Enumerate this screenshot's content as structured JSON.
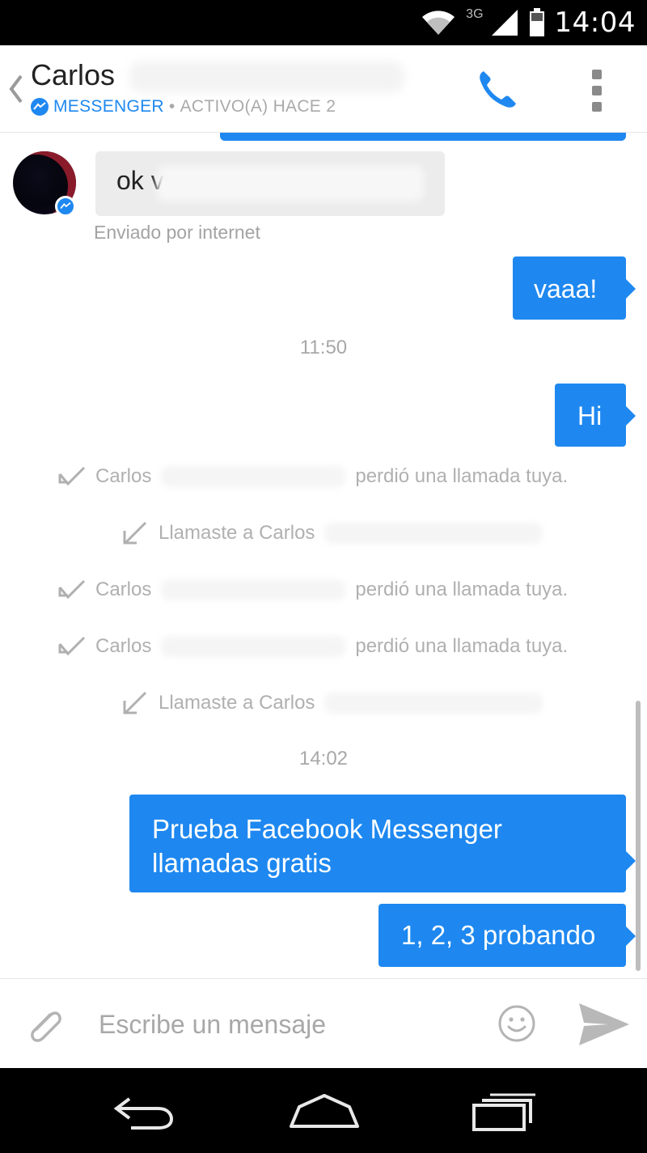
{
  "status_bar": {
    "time": "14:04",
    "network": "3G",
    "icons": [
      "wifi-icon",
      "signal-icon",
      "battery-icon"
    ]
  },
  "header": {
    "contact_name": "Carlos",
    "app_label": "MESSENGER",
    "separator": "•",
    "status": "ACTIVO(A) HACE 2",
    "icons": [
      "back-icon",
      "phone-icon",
      "more-icon"
    ]
  },
  "conversation": {
    "incoming": {
      "text": "ok v",
      "note": "Enviado por internet"
    },
    "outgoing_1": "vaaa!",
    "time_1": "11:50",
    "outgoing_2": "Hi",
    "call_log": [
      {
        "type": "missed",
        "name": "Carlos",
        "text": "perdió una llamada tuya."
      },
      {
        "type": "outgoing",
        "text": "Llamaste a Carlos"
      },
      {
        "type": "missed",
        "name": "Carlos",
        "text": "perdió una llamada tuya."
      },
      {
        "type": "missed",
        "name": "Carlos",
        "text": "perdió una llamada tuya."
      },
      {
        "type": "outgoing",
        "text": "Llamaste a Carlos"
      }
    ],
    "time_2": "14:02",
    "outgoing_3_line1": "Prueba Facebook Messenger",
    "outgoing_3_line2": "llamadas gratis",
    "outgoing_4": "1, 2, 3 probando"
  },
  "composer": {
    "placeholder": "Escribe un mensaje",
    "icons": [
      "attach-icon",
      "emoji-icon",
      "send-icon"
    ]
  },
  "colors": {
    "accent": "#1e88f0",
    "incoming_bubble": "#ececec",
    "muted_text": "#a8a8a8"
  }
}
